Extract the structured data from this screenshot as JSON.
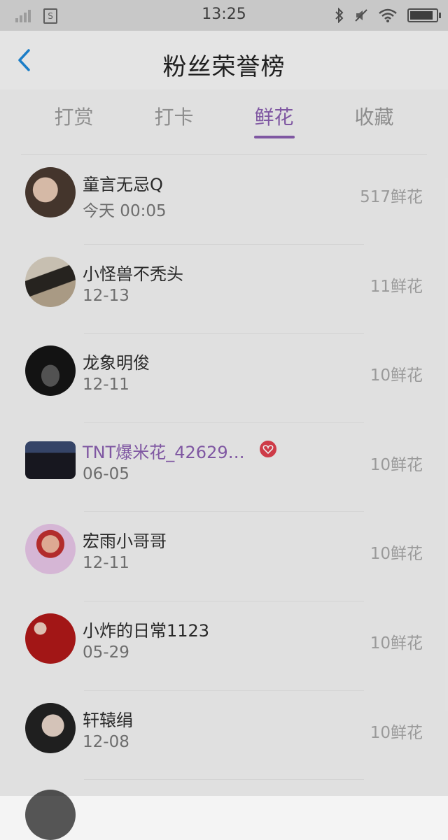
{
  "status_bar": {
    "time": "13:25",
    "icons": [
      "signal-icon",
      "notification-icon",
      "bluetooth-icon",
      "mute-icon",
      "wifi-icon",
      "battery-icon"
    ],
    "battery_level": 0.9
  },
  "header": {
    "back_icon": "chevron-left-icon",
    "title": "粉丝荣誉榜"
  },
  "tabs": [
    {
      "label": "打赏",
      "active": false
    },
    {
      "label": "打卡",
      "active": false
    },
    {
      "label": "鲜花",
      "active": true
    },
    {
      "label": "收藏",
      "active": false
    }
  ],
  "colors": {
    "accent": "#8a5fb0",
    "vip_badge": "#e0404f",
    "back_icon": "#1e88d8"
  },
  "list": [
    {
      "name": "童言无忌Q",
      "date": "今天 00:05",
      "count": "517鲜花",
      "vip": false
    },
    {
      "name": "小怪兽不秃头",
      "date": "12-13",
      "count": "11鲜花",
      "vip": false
    },
    {
      "name": "龙象明俊",
      "date": "12-11",
      "count": "10鲜花",
      "vip": false
    },
    {
      "name": "TNT爆米花_42629…",
      "date": "06-05",
      "count": "10鲜花",
      "vip": true
    },
    {
      "name": "宏雨小哥哥",
      "date": "12-11",
      "count": "10鲜花",
      "vip": false
    },
    {
      "name": "小炸的日常1123",
      "date": "05-29",
      "count": "10鲜花",
      "vip": false
    },
    {
      "name": "轩辕绢",
      "date": "12-08",
      "count": "10鲜花",
      "vip": false
    }
  ]
}
